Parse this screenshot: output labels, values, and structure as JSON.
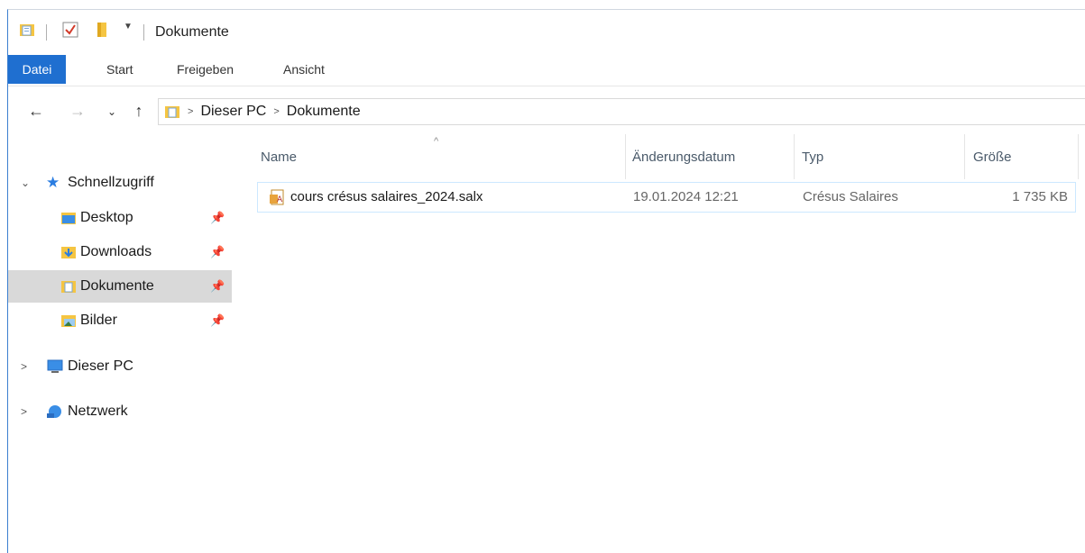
{
  "window": {
    "title": "Dokumente"
  },
  "ribbon": {
    "tabs": [
      {
        "label": "Datei"
      },
      {
        "label": "Start"
      },
      {
        "label": "Freigeben"
      },
      {
        "label": "Ansicht"
      }
    ]
  },
  "address": {
    "breadcrumb": [
      "Dieser PC",
      "Dokumente"
    ]
  },
  "sidebar": {
    "quick_access": "Schnellzugriff",
    "items": [
      {
        "label": "Desktop",
        "icon": "desktop-folder-icon"
      },
      {
        "label": "Downloads",
        "icon": "downloads-folder-icon"
      },
      {
        "label": "Dokumente",
        "icon": "documents-folder-icon",
        "selected": true
      },
      {
        "label": "Bilder",
        "icon": "pictures-folder-icon"
      }
    ],
    "this_pc": "Dieser PC",
    "network": "Netzwerk"
  },
  "columns": {
    "name": "Name",
    "date": "Änderungsdatum",
    "type": "Typ",
    "size": "Größe"
  },
  "files": [
    {
      "name": "cours crésus salaires_2024.salx",
      "date": "19.01.2024 12:21",
      "type": "Crésus Salaires",
      "size": "1 735 KB"
    }
  ],
  "colors": {
    "accent": "#1f6fd0",
    "selection_border": "#cce8ff",
    "nav_selected": "#d9d9d9",
    "folder_yellow": "#f5c542"
  }
}
